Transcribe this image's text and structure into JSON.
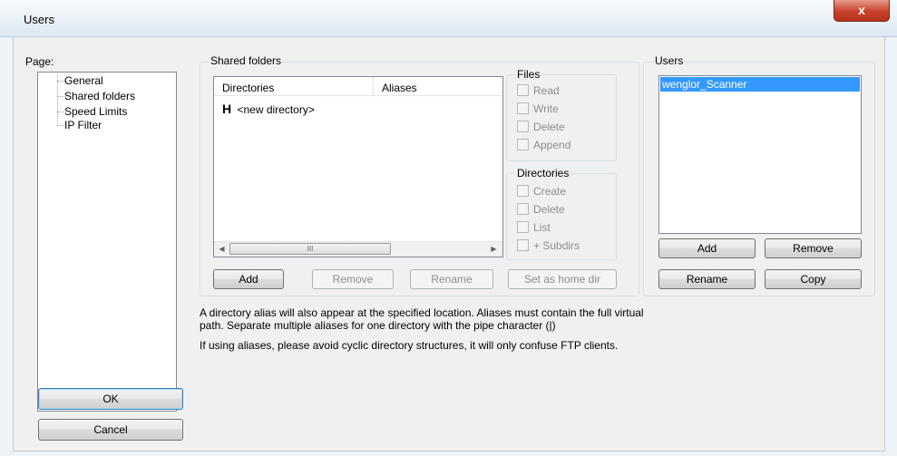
{
  "window": {
    "title": "Users",
    "close_glyph": "x"
  },
  "page_panel": {
    "label": "Page:",
    "items": [
      "General",
      "Shared folders",
      "Speed Limits",
      "IP Filter"
    ]
  },
  "shared_folders": {
    "group_label": "Shared folders",
    "columns": [
      "Directories",
      "Aliases"
    ],
    "rows": [
      {
        "icon": "H",
        "name": "<new directory>"
      }
    ],
    "scroll_thumb_glyph": "III",
    "buttons": {
      "add": "Add",
      "remove": "Remove",
      "rename": "Rename",
      "set_home": "Set as home dir"
    }
  },
  "files": {
    "label": "Files",
    "options": [
      "Read",
      "Write",
      "Delete",
      "Append"
    ]
  },
  "directories": {
    "label": "Directories",
    "options": [
      "Create",
      "Delete",
      "List",
      "+ Subdirs"
    ]
  },
  "users": {
    "label": "Users",
    "list": [
      "wenglor_Scanner"
    ],
    "buttons": {
      "add": "Add",
      "remove": "Remove",
      "rename": "Rename",
      "copy": "Copy"
    }
  },
  "info": {
    "line1": "A directory alias will also appear at the specified location. Aliases must contain the full virtual",
    "line2": "path. Separate multiple aliases for one directory with the pipe character (|)",
    "line3": "If using aliases, please avoid cyclic directory structures, it will only confuse FTP clients."
  },
  "dialog_buttons": {
    "ok": "OK",
    "cancel": "Cancel"
  },
  "colors": {
    "selection": "#3399ff",
    "accent_border": "#3c7fb1",
    "close_red": "#c9412c"
  }
}
